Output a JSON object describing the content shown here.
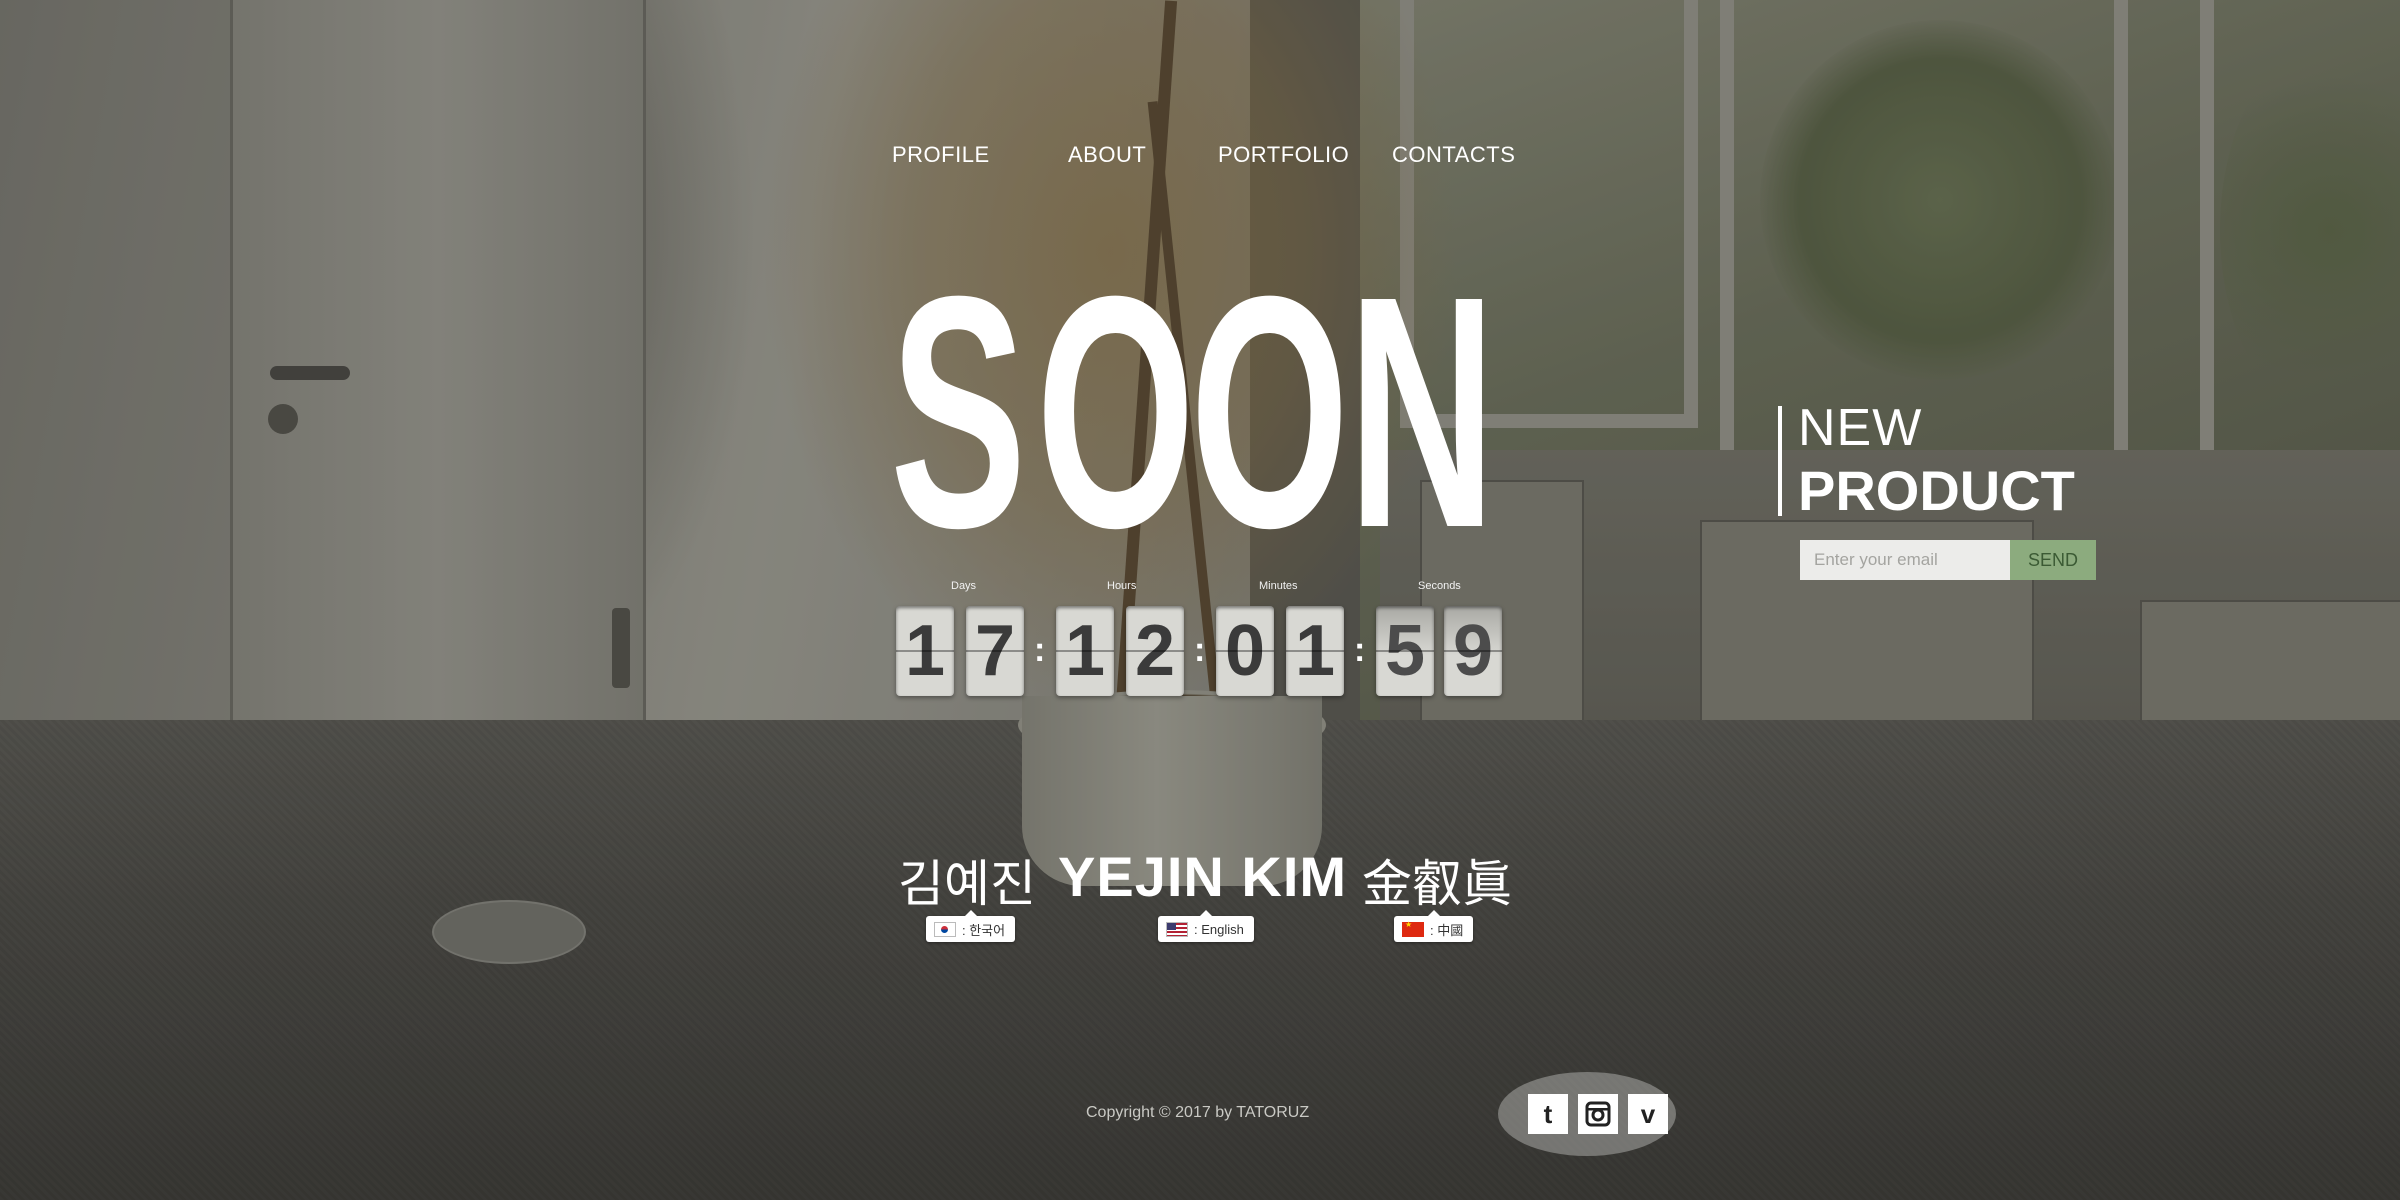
{
  "nav": {
    "items": [
      {
        "label": "PROFILE"
      },
      {
        "label": "ABOUT"
      },
      {
        "label": "PORTFOLIO"
      },
      {
        "label": "CONTACTS"
      }
    ]
  },
  "hero": {
    "headline": [
      "S",
      "O",
      "O",
      "N"
    ]
  },
  "countdown": {
    "labels": {
      "days": "Days",
      "hours": "Hours",
      "minutes": "Minutes",
      "seconds": "Seconds"
    },
    "days": [
      "1",
      "7"
    ],
    "hours": [
      "1",
      "2"
    ],
    "minutes": [
      "0",
      "1"
    ],
    "seconds": [
      "5",
      "9"
    ],
    "separator": ":"
  },
  "names": {
    "korean": "김예진",
    "english": "YEJIN KIM",
    "chinese": "金叡眞"
  },
  "languages": [
    {
      "label": ": 한국어",
      "flag": "flag-kr-icon"
    },
    {
      "label": ": English",
      "flag": "flag-us-icon"
    },
    {
      "label": ": 中國",
      "flag": "flag-cn-icon"
    }
  ],
  "new_product": {
    "line1": "NEW",
    "line2": "PRODUCT",
    "email_placeholder": "Enter your email",
    "send_label": "SEND",
    "accent_color": "#8cab7e"
  },
  "footer": {
    "copyright": "Copyright © 2017 by TATORUZ",
    "social": [
      {
        "name": "tumblr-icon",
        "glyph": "t"
      },
      {
        "name": "instagram-icon",
        "glyph": ""
      },
      {
        "name": "vimeo-icon",
        "glyph": "v"
      }
    ]
  }
}
